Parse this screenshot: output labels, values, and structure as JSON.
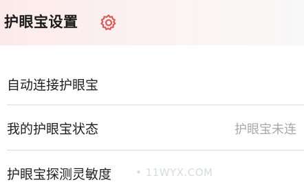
{
  "header": {
    "title": "护眼宝设置",
    "icon": "gear-icon",
    "accent_color": "#e2524f"
  },
  "settings": [
    {
      "label": "自动连接护眼宝"
    },
    {
      "label": "我的护眼宝状态",
      "value": "护眼宝未连"
    },
    {
      "label": "护眼宝探测灵敏度"
    }
  ],
  "watermark": "• 11WYX.COM"
}
